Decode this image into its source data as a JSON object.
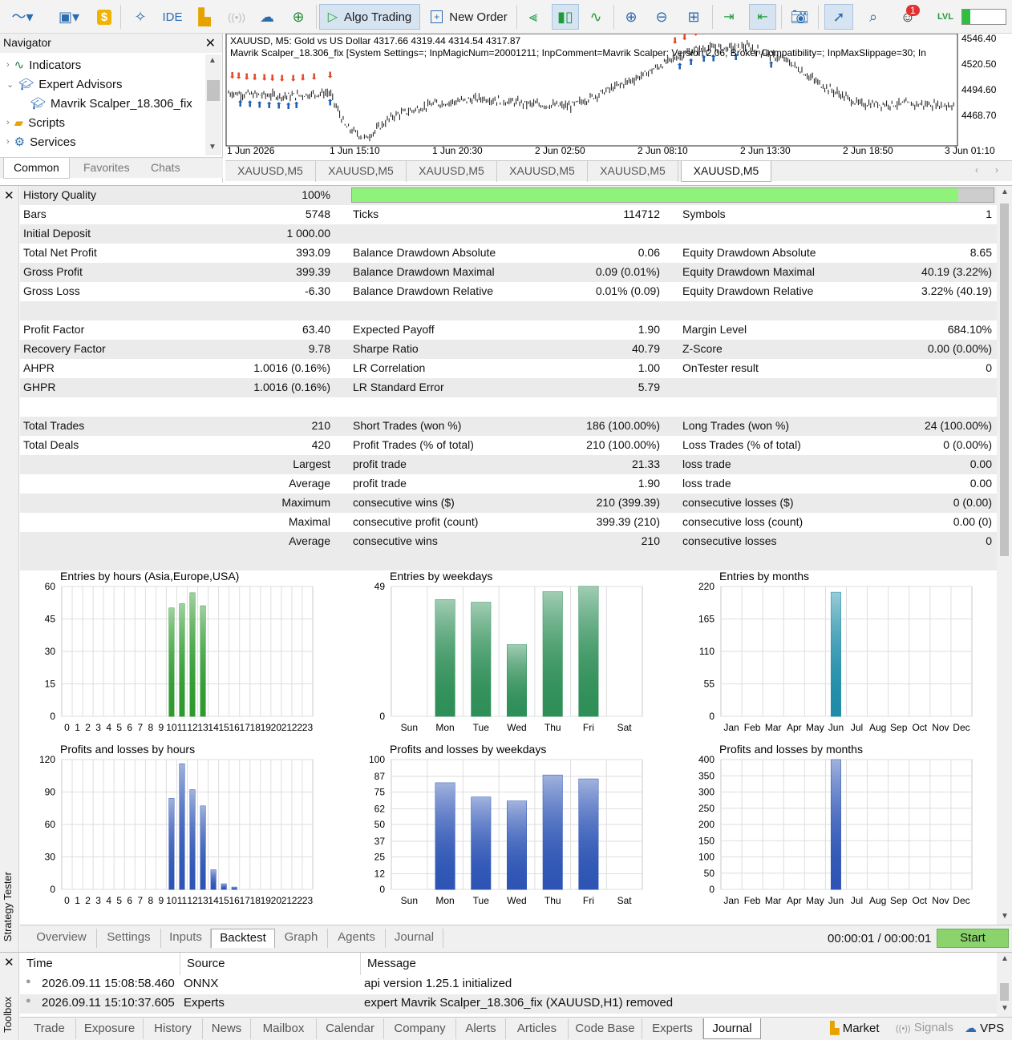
{
  "toolbar": {
    "ide_label": "IDE",
    "algo_trading_label": "Algo Trading",
    "new_order_label": "New Order",
    "notification_count": "1",
    "lvl_label": "LVL"
  },
  "navigator": {
    "title": "Navigator",
    "items": [
      {
        "label": "Indicators"
      },
      {
        "label": "Expert Advisors"
      },
      {
        "label": "Mavrik Scalper_18.306_fix"
      },
      {
        "label": "Scripts"
      },
      {
        "label": "Services"
      }
    ],
    "tabs": [
      "Common",
      "Favorites",
      "Chats"
    ]
  },
  "chart": {
    "symbol_line": "XAUUSD, M5:  Gold vs US Dollar  4317.66 4319.44 4314.54 4317.87",
    "ea_line": "Mavrik Scalper_18.306_fix [System Settings=; InpMagicNum=20001211; InpComment=Mavrik Scalper; Version 2.06; Broker Compatibility=; InpMaxSlippage=30; In",
    "price_labels": [
      "4546.40",
      "4520.50",
      "4494.60",
      "4468.70"
    ],
    "time_labels": [
      "1 Jun 2026",
      "1 Jun 15:10",
      "1 Jun 20:30",
      "2 Jun 02:50",
      "2 Jun 08:10",
      "2 Jun 13:30",
      "2 Jun 18:50",
      "3 Jun 01:10"
    ],
    "tabs": [
      "XAUUSD,M5",
      "XAUUSD,M5",
      "XAUUSD,M5",
      "XAUUSD,M5",
      "XAUUSD,M5",
      "XAUUSD,M5"
    ]
  },
  "tester": {
    "side_label": "Strategy Tester",
    "history_quality": {
      "label": "History Quality",
      "value": "100%",
      "fraction": 0.945
    },
    "rows": [
      [
        "Bars",
        "5748",
        "Ticks",
        "114712",
        "Symbols",
        "1"
      ],
      [
        "Initial Deposit",
        "1 000.00",
        "",
        "",
        "",
        ""
      ],
      [
        "Total Net Profit",
        "393.09",
        "Balance Drawdown Absolute",
        "0.06",
        "Equity Drawdown Absolute",
        "8.65"
      ],
      [
        "Gross Profit",
        "399.39",
        "Balance Drawdown Maximal",
        "0.09 (0.01%)",
        "Equity Drawdown Maximal",
        "40.19 (3.22%)"
      ],
      [
        "Gross Loss",
        "-6.30",
        "Balance Drawdown Relative",
        "0.01% (0.09)",
        "Equity Drawdown Relative",
        "3.22% (40.19)"
      ],
      [
        "",
        "",
        "",
        "",
        "",
        ""
      ],
      [
        "Profit Factor",
        "63.40",
        "Expected Payoff",
        "1.90",
        "Margin Level",
        "684.10%"
      ],
      [
        "Recovery Factor",
        "9.78",
        "Sharpe Ratio",
        "40.79",
        "Z-Score",
        "0.00 (0.00%)"
      ],
      [
        "AHPR",
        "1.0016 (0.16%)",
        "LR Correlation",
        "1.00",
        "OnTester result",
        "0"
      ],
      [
        "GHPR",
        "1.0016 (0.16%)",
        "LR Standard Error",
        "5.79",
        "",
        ""
      ],
      [
        "",
        "",
        "",
        "",
        "",
        ""
      ],
      [
        "Total Trades",
        "210",
        "Short Trades (won %)",
        "186 (100.00%)",
        "Long Trades (won %)",
        "24 (100.00%)"
      ],
      [
        "Total Deals",
        "420",
        "Profit Trades (% of total)",
        "210 (100.00%)",
        "Loss Trades (% of total)",
        "0 (0.00%)"
      ],
      [
        "",
        "Largest",
        "profit trade",
        "21.33",
        "loss trade",
        "0.00"
      ],
      [
        "",
        "Average",
        "profit trade",
        "1.90",
        "loss trade",
        "0.00"
      ],
      [
        "",
        "Maximum",
        "consecutive wins ($)",
        "210 (399.39)",
        "consecutive losses ($)",
        "0 (0.00)"
      ],
      [
        "",
        "Maximal",
        "consecutive profit (count)",
        "399.39 (210)",
        "consecutive loss (count)",
        "0.00 (0)"
      ],
      [
        "",
        "Average",
        "consecutive wins",
        "210",
        "consecutive losses",
        "0"
      ]
    ],
    "tabs": [
      "Overview",
      "Settings",
      "Inputs",
      "Backtest",
      "Graph",
      "Agents",
      "Journal"
    ],
    "timer": "00:00:01 / 00:00:01",
    "start_label": "Start"
  },
  "chart_data": [
    {
      "type": "bar",
      "title": "Entries by hours (Asia,Europe,USA)",
      "categories": [
        "0",
        "1",
        "2",
        "3",
        "4",
        "5",
        "6",
        "7",
        "8",
        "9",
        "10",
        "11",
        "12",
        "13",
        "14",
        "15",
        "16",
        "17",
        "18",
        "19",
        "20",
        "21",
        "22",
        "23"
      ],
      "values": [
        0,
        0,
        0,
        0,
        0,
        0,
        0,
        0,
        0,
        0,
        50,
        52,
        57,
        51,
        0,
        0,
        0,
        0,
        0,
        0,
        0,
        0,
        0,
        0
      ],
      "yticks": [
        "0",
        "15",
        "30",
        "45",
        "60"
      ],
      "ylim": [
        0,
        60
      ],
      "color": "#2e9a2e"
    },
    {
      "type": "bar",
      "title": "Entries by weekdays",
      "categories": [
        "Sun",
        "Mon",
        "Tue",
        "Wed",
        "Thu",
        "Fri",
        "Sat"
      ],
      "values": [
        0,
        44,
        43,
        27,
        47,
        49,
        0
      ],
      "yticks": [
        "0",
        "49"
      ],
      "ylim": [
        0,
        49
      ],
      "color": "#2f8f58"
    },
    {
      "type": "bar",
      "title": "Entries by months",
      "categories": [
        "Jan",
        "Feb",
        "Mar",
        "Apr",
        "May",
        "Jun",
        "Jul",
        "Aug",
        "Sep",
        "Oct",
        "Nov",
        "Dec"
      ],
      "values": [
        0,
        0,
        0,
        0,
        0,
        210,
        0,
        0,
        0,
        0,
        0,
        0
      ],
      "yticks": [
        "0",
        "55",
        "110",
        "165",
        "220"
      ],
      "ylim": [
        0,
        220
      ],
      "color": "#1f8ca8"
    },
    {
      "type": "bar",
      "title": "Profits and losses by hours",
      "categories": [
        "0",
        "1",
        "2",
        "3",
        "4",
        "5",
        "6",
        "7",
        "8",
        "9",
        "10",
        "11",
        "12",
        "13",
        "14",
        "15",
        "16",
        "17",
        "18",
        "19",
        "20",
        "21",
        "22",
        "23"
      ],
      "values": [
        0,
        0,
        0,
        0,
        0,
        0,
        0,
        0,
        0,
        0,
        84,
        116,
        92,
        77,
        18,
        5,
        2,
        0,
        0,
        0,
        0,
        0,
        0,
        0
      ],
      "yticks": [
        "0",
        "30",
        "60",
        "90",
        "120"
      ],
      "ylim": [
        0,
        120
      ],
      "color": "#2e55b5"
    },
    {
      "type": "bar",
      "title": "Profits and losses by weekdays",
      "categories": [
        "Sun",
        "Mon",
        "Tue",
        "Wed",
        "Thu",
        "Fri",
        "Sat"
      ],
      "values": [
        0,
        82,
        71,
        68,
        88,
        85,
        0
      ],
      "yticks": [
        "0",
        "12",
        "25",
        "37",
        "50",
        "62",
        "75",
        "87",
        "100"
      ],
      "ylim": [
        0,
        100
      ],
      "color": "#2e55b5"
    },
    {
      "type": "bar",
      "title": "Profits and losses by months",
      "categories": [
        "Jan",
        "Feb",
        "Mar",
        "Apr",
        "May",
        "Jun",
        "Jul",
        "Aug",
        "Sep",
        "Oct",
        "Nov",
        "Dec"
      ],
      "values": [
        0,
        0,
        0,
        0,
        0,
        399.39,
        0,
        0,
        0,
        0,
        0,
        0
      ],
      "yticks": [
        "0",
        "50",
        "100",
        "150",
        "200",
        "250",
        "300",
        "350",
        "400"
      ],
      "ylim": [
        0,
        400
      ],
      "color": "#2e55b5"
    }
  ],
  "journal": {
    "side_label": "Toolbox",
    "headers": [
      "Time",
      "Source",
      "Message"
    ],
    "rows": [
      {
        "time": "2026.09.11 15:08:58.460",
        "source": "ONNX",
        "message": "api version 1.25.1 initialized"
      },
      {
        "time": "2026.09.11 15:10:37.605",
        "source": "Experts",
        "message": "expert Mavrik Scalper_18.306_fix (XAUUSD,H1) removed"
      }
    ],
    "tabs": [
      "Trade",
      "Exposure",
      "History",
      "News",
      "Mailbox",
      "Calendar",
      "Company",
      "Alerts",
      "Articles",
      "Code Base",
      "Experts",
      "Journal"
    ],
    "market_label": "Market",
    "signals_label": "Signals",
    "vps_label": "VPS"
  }
}
